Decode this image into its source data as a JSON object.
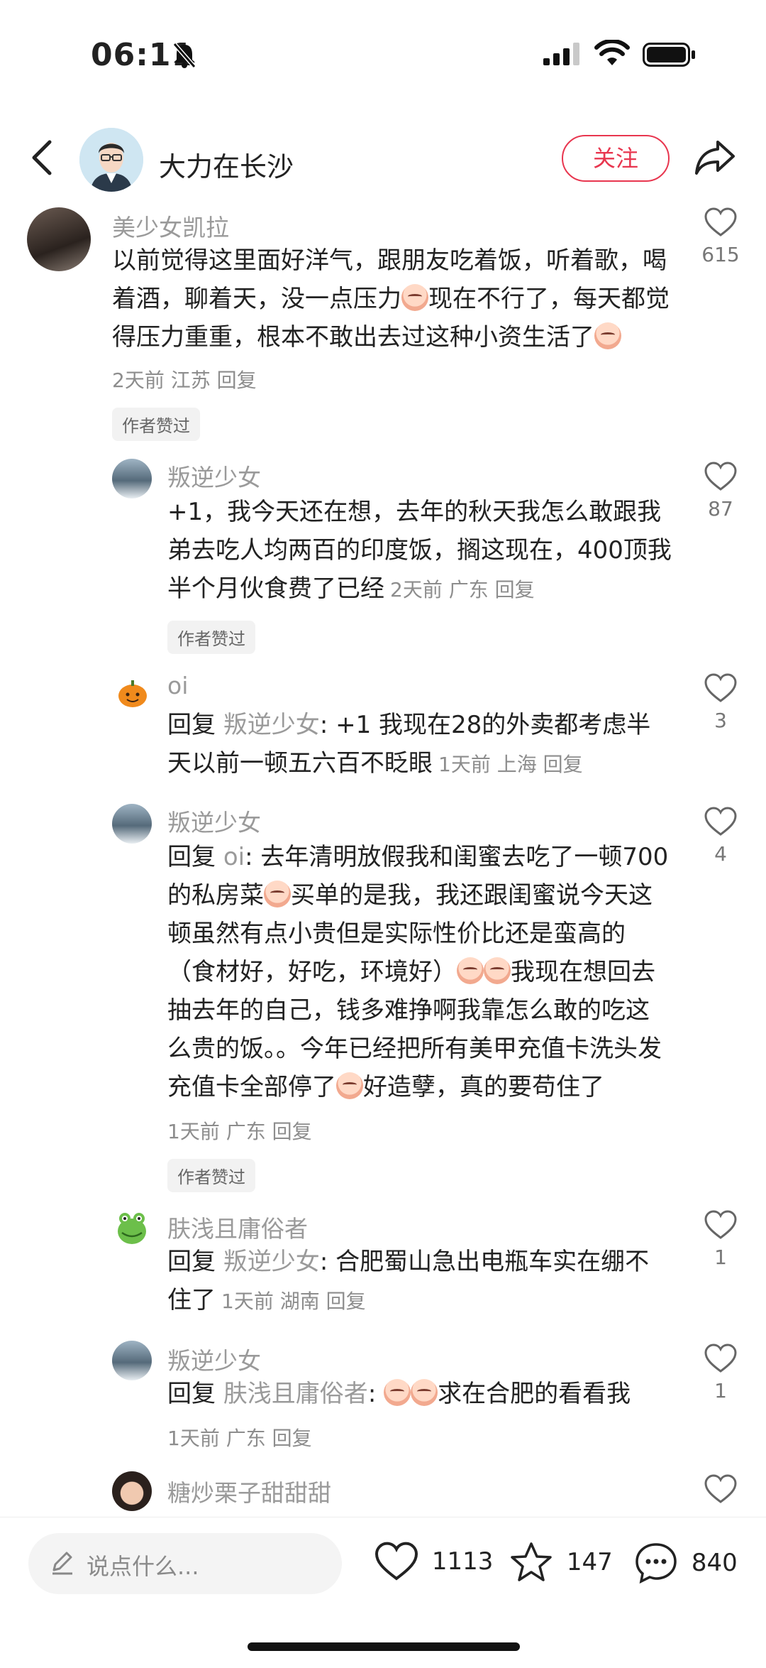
{
  "status_bar": {
    "time": "06:11"
  },
  "header": {
    "author": "大力在长沙",
    "follow_label": "关注"
  },
  "comments": [
    {
      "user": "美少女凯拉",
      "text_a": "以前觉得这里面好洋气，跟朋友吃着饭，听着歌，喝着酒，聊着天，没一点压力",
      "text_b": "现在不行了，每天都觉得压力重重，根本不敢出去过这种小资生活了",
      "meta": "2天前 江苏 回复",
      "badge": "作者赞过",
      "likes": "615"
    },
    {
      "user": "叛逆少女",
      "text": "+1，我今天还在想，去年的秋天我怎么敢跟我弟去吃人均两百的印度饭，搁这现在，400顶我半个月伙食费了已经",
      "meta": "2天前 广东 回复",
      "badge": "作者赞过",
      "likes": "87"
    },
    {
      "user": "oi",
      "reply_kw": "回复",
      "reply_to": "叛逆少女",
      "text": ": +1 我现在28的外卖都考虑半天以前一顿五六百不眨眼",
      "meta": "1天前 上海 回复",
      "likes": "3"
    },
    {
      "user": "叛逆少女",
      "reply_kw": "回复",
      "reply_to": "oi",
      "text_a": ": 去年清明放假我和闺蜜去吃了一顿700的私房菜",
      "text_b": "买单的是我，我还跟闺蜜说今天这顿虽然有点小贵但是实际性价比还是蛮高的（食材好，好吃，环境好）",
      "text_c": "我现在想回去抽去年的自己，钱多难挣啊我靠怎么敢的吃这么贵的饭。。今年已经把所有美甲充值卡洗头发充值卡全部停了",
      "text_d": "好造孽，真的要苟住了",
      "meta": "1天前 广东 回复",
      "badge": "作者赞过",
      "likes": "4"
    },
    {
      "user": "肤浅且庸俗者",
      "reply_kw": "回复",
      "reply_to": "叛逆少女",
      "text": ": 合肥蜀山急出电瓶车实在绷不住了",
      "meta": "1天前 湖南 回复",
      "likes": "1"
    },
    {
      "user": "叛逆少女",
      "reply_kw": "回复",
      "reply_to": "肤浅且庸俗者",
      "text_a": ": ",
      "text_b": "求在合肥的看看我",
      "meta": "1天前 广东 回复",
      "likes": "1"
    },
    {
      "user": "糖炒栗子甜甜甜"
    }
  ],
  "bottom_bar": {
    "placeholder": "说点什么...",
    "likes": "1113",
    "favorites": "147",
    "comments": "840"
  }
}
